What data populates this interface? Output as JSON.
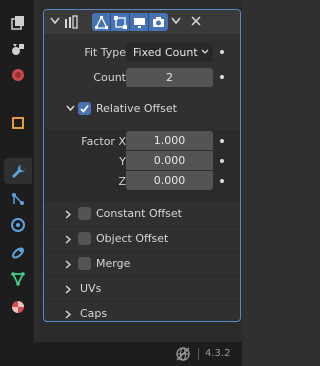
{
  "tabs": [
    {
      "name": "view-layer-icon",
      "active": false
    },
    {
      "name": "scene-icon",
      "active": false
    },
    {
      "name": "world-icon",
      "active": false
    },
    {
      "name": "object-icon",
      "active": false
    },
    {
      "name": "modifier-wrench-icon",
      "active": true
    },
    {
      "name": "particles-icon",
      "active": false
    },
    {
      "name": "physics-icon",
      "active": false
    },
    {
      "name": "constraints-icon",
      "active": false
    },
    {
      "name": "data-mesh-icon",
      "active": false
    },
    {
      "name": "material-icon",
      "active": false
    }
  ],
  "modifier": {
    "header_toggles": [
      "edit-mode-icon",
      "on-cage-icon",
      "realtime-viewport-icon",
      "render-camera-icon"
    ],
    "fit_type": {
      "label": "Fit Type",
      "value": "Fixed Count"
    },
    "count": {
      "label": "Count",
      "value": "2"
    },
    "relative_offset": {
      "label": "Relative Offset",
      "checked": true,
      "factor_label": "Factor X",
      "y_label": "Y",
      "z_label": "Z",
      "factor_x": "1.000",
      "y": "0.000",
      "z": "0.000"
    },
    "subpanels": {
      "constant_offset": "Constant Offset",
      "object_offset": "Object Offset",
      "merge": "Merge",
      "uvs": "UVs",
      "caps": "Caps"
    }
  },
  "status": {
    "version": "4.3.2"
  },
  "colors": {
    "accent": "#4772b3",
    "panel_outline": "#5a87c9"
  }
}
